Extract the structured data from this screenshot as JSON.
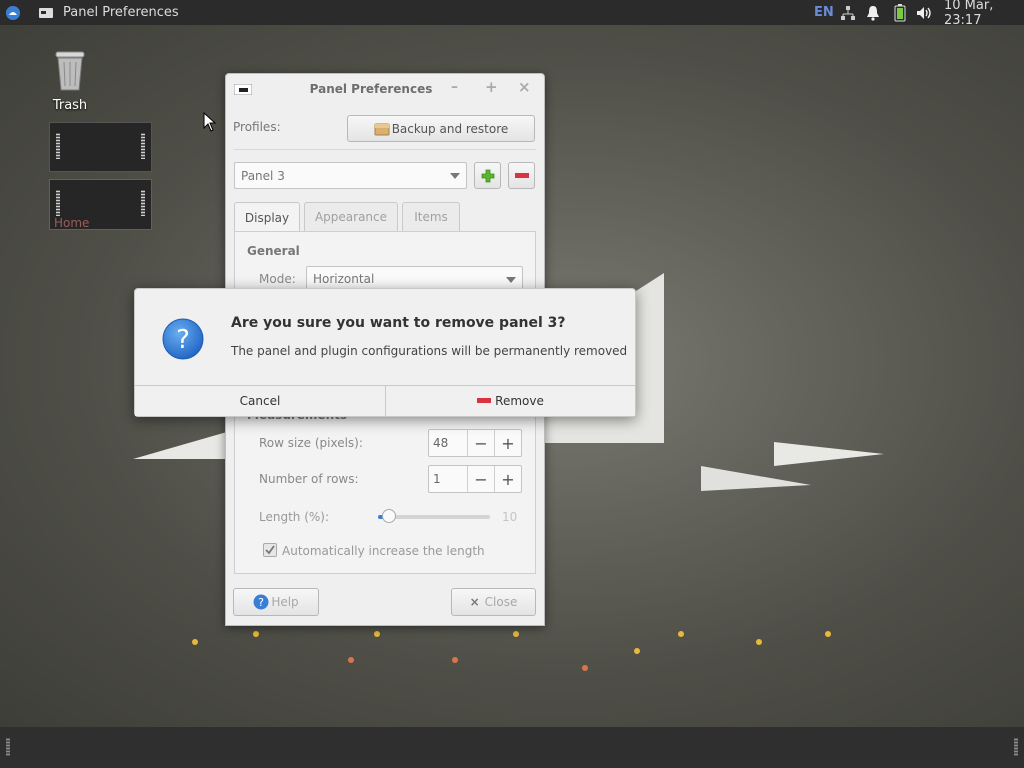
{
  "topbar": {
    "app_title": "Panel Preferences",
    "keyboard_layout": "EN",
    "clock": "10 Mar, 23:17"
  },
  "desktop": {
    "trash_label": "Trash",
    "home_label": "Home"
  },
  "window": {
    "title": "Panel Preferences",
    "profiles_label": "Profiles:",
    "backup_button": "Backup and restore",
    "panel_select": "Panel 3",
    "tabs": [
      {
        "label": "Display",
        "active": true
      },
      {
        "label": "Appearance",
        "active": false
      },
      {
        "label": "Items",
        "active": false
      }
    ],
    "general": {
      "heading": "General",
      "mode_label": "Mode:",
      "mode_value": "Horizontal"
    },
    "measurements": {
      "heading": "Measurements",
      "row_size_label": "Row size (pixels):",
      "row_size_value": "48",
      "rows_label": "Number of rows:",
      "rows_value": "1",
      "length_label": "Length (%):",
      "length_value": "10",
      "length_fraction": 0.1,
      "auto_length_label": "Automatically increase the length",
      "auto_length_checked": true
    },
    "help_button": "Help",
    "close_button": "Close"
  },
  "dialog": {
    "title": "Are you sure you want to remove panel 3?",
    "message": "The panel and plugin configurations will be permanently removed",
    "cancel_button": "Cancel",
    "remove_button": "Remove"
  },
  "colors": {
    "topbar_bg": "#2b2b2b",
    "accent_blue": "#3a7fd6",
    "remove_red": "#d9333f",
    "add_green": "#5ab531",
    "battery_green": "#7ac943",
    "layout_blue": "#6a8bd6"
  },
  "icons": [
    "xfce-menu-icon",
    "window-icon",
    "network-icon",
    "bell-icon",
    "battery-icon",
    "volume-icon",
    "trash-icon",
    "help-icon",
    "question-icon",
    "add-icon",
    "remove-icon",
    "close-icon",
    "minimize-icon",
    "maximize-icon"
  ]
}
